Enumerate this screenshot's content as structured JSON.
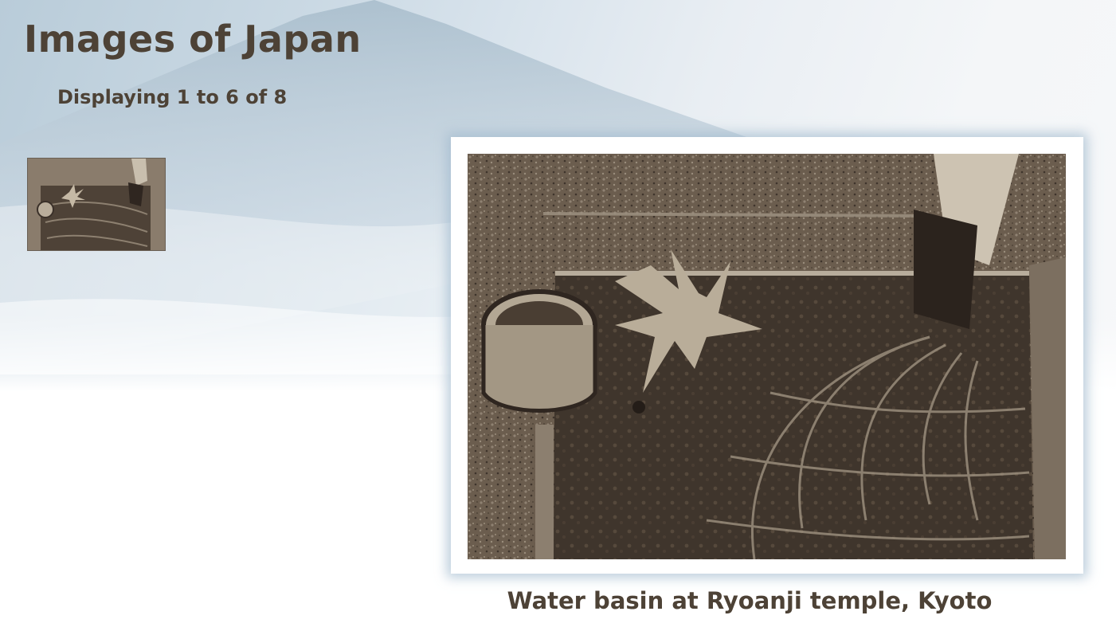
{
  "page": {
    "title": "Images of Japan",
    "paging_status": "Displaying 1 to 6 of 8"
  },
  "thumbnails": [
    {
      "icon": "water-basin-thumbnail-image",
      "selected": true
    }
  ],
  "main_photo": {
    "icon": "water-basin-photo",
    "caption": "Water basin at Ryoanji temple, Kyoto"
  },
  "colors": {
    "text": "#4d4236",
    "frame": "#ffffff",
    "photo_tone": "#5a4c3e"
  }
}
